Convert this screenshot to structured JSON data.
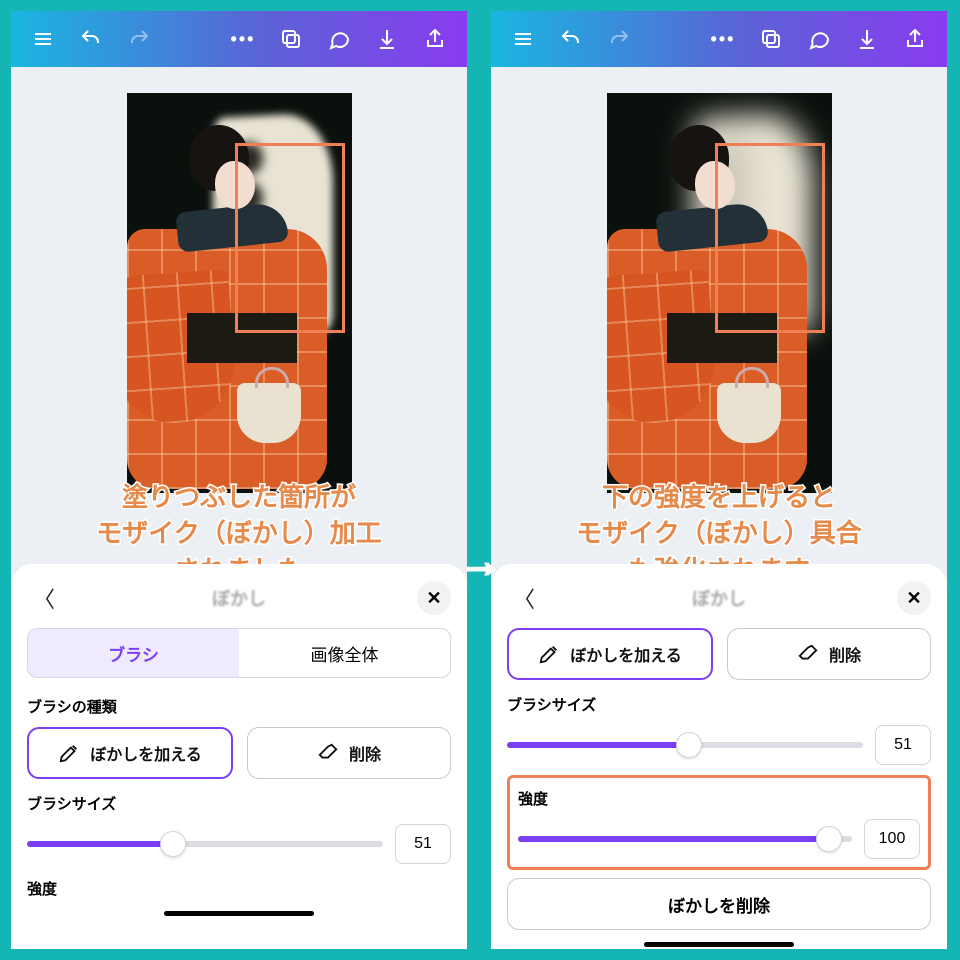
{
  "toolbar": {
    "icons": [
      "menu",
      "undo",
      "redo",
      "more",
      "copy",
      "comment",
      "download",
      "share"
    ]
  },
  "annotations": {
    "left_line1": "塗りつぶした箇所が",
    "left_line2": "モザイク（ぼかし）加工",
    "left_line3": "されました",
    "right_line1": "下の強度を上げると",
    "right_line2": "モザイク（ぼかし）具合",
    "right_line3": "も強化されます"
  },
  "panel": {
    "title": "ぼかし",
    "tabs": {
      "brush": "ブラシ",
      "whole": "画像全体"
    },
    "brushTypeLabel": "ブラシの種類",
    "addBlur": "ぼかしを加える",
    "erase": "削除",
    "brushSizeLabel": "ブラシサイズ",
    "intensityLabel": "強度",
    "removeBlur": "ぼかしを削除"
  },
  "left": {
    "brushSize": {
      "value": "51",
      "pct": 41
    }
  },
  "right": {
    "brushSize": {
      "value": "51",
      "pct": 51
    },
    "intensity": {
      "value": "100",
      "pct": 93
    }
  }
}
